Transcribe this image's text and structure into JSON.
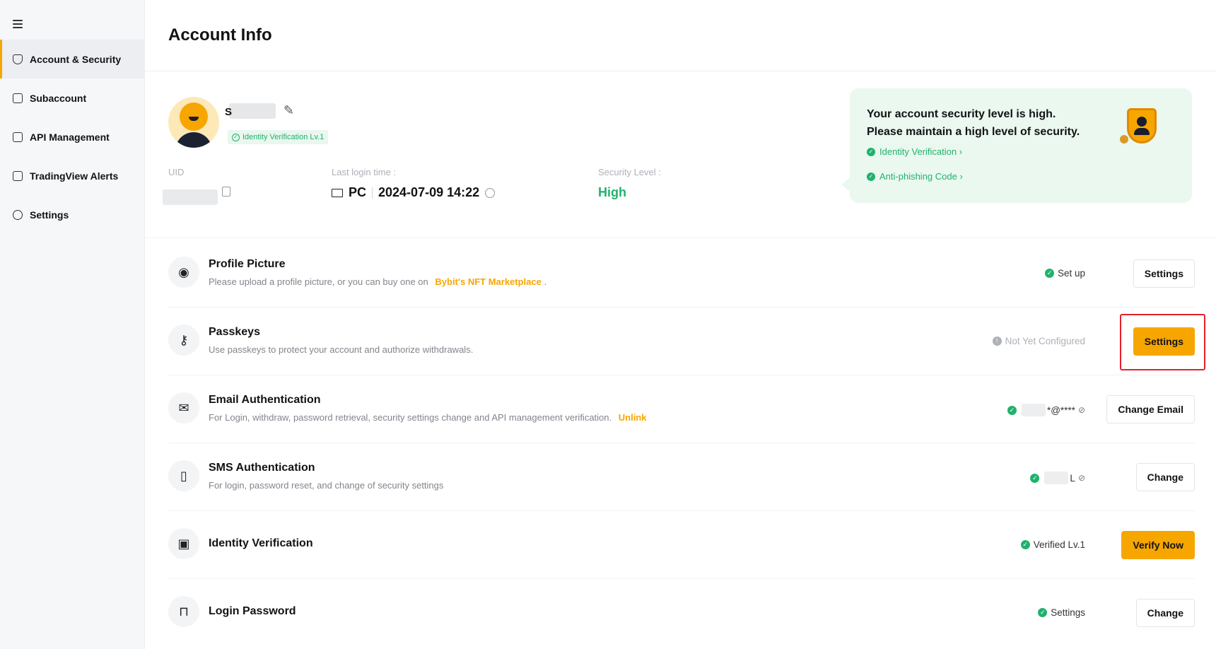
{
  "sidebar": {
    "items": [
      {
        "label": "Account & Security",
        "icon": "shield-icon",
        "active": true
      },
      {
        "label": "Subaccount",
        "icon": "subaccount-icon",
        "active": false
      },
      {
        "label": "API Management",
        "icon": "api-icon",
        "active": false
      },
      {
        "label": "TradingView Alerts",
        "icon": "alert-icon",
        "active": false
      },
      {
        "label": "Settings",
        "icon": "gear-icon",
        "active": false
      }
    ]
  },
  "page": {
    "title": "Account Info"
  },
  "profile": {
    "name_initial": "S",
    "identity_badge": "Identity Verification Lv.1",
    "uid_label": "UID",
    "login_label": "Last login time :",
    "login_device": "PC",
    "login_time": "2024-07-09 14:22",
    "security_label": "Security Level :",
    "security_value": "High"
  },
  "security_card": {
    "line1": "Your account security level is high.",
    "line2": "Please maintain a high level of security.",
    "link1": "Identity Verification ›",
    "link2": "Anti-phishing Code ›"
  },
  "rows": [
    {
      "title": "Profile Picture",
      "desc": "Please upload a profile picture, or you can buy one on",
      "desc_link": "Bybit's NFT Marketplace",
      "desc_suffix": ".",
      "status": "Set up",
      "button": "Settings"
    },
    {
      "title": "Passkeys",
      "desc": "Use passkeys to protect your account and authorize withdrawals.",
      "status": "Not Yet Configured",
      "button": "Settings"
    },
    {
      "title": "Email Authentication",
      "desc": "For Login, withdraw, password retrieval, security settings change and API management verification.",
      "desc_link": "Unlink",
      "status": "*@****",
      "button": "Change Email"
    },
    {
      "title": "SMS Authentication",
      "desc": "For login, password reset, and change of security settings",
      "status": "L",
      "button": "Change"
    },
    {
      "title": "Identity Verification",
      "status": "Verified Lv.1",
      "button": "Verify Now"
    },
    {
      "title": "Login Password",
      "status": "Settings",
      "button": "Change"
    }
  ],
  "colors": {
    "accent": "#f7a600",
    "success": "#20b26c",
    "highlight": "#e5202a"
  }
}
